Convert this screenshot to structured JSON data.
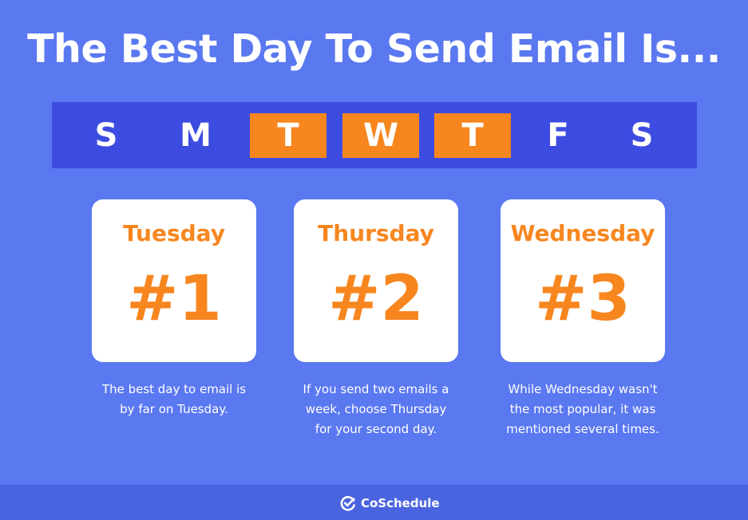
{
  "title": "The Best Day To Send Email Is...",
  "days": [
    "S",
    "M",
    "T",
    "W",
    "T",
    "F",
    "S"
  ],
  "highlighted_days": [
    2,
    3,
    4
  ],
  "colors": {
    "background": "#5a78f0",
    "strip": "#3d4ce0",
    "accent": "#f7861f",
    "card": "#ffffff",
    "footer": "#4a64e0"
  },
  "cards": [
    {
      "day": "Tuesday",
      "rank": "#1",
      "description": [
        "The best day to email is",
        "by far on Tuesday."
      ]
    },
    {
      "day": "Thursday",
      "rank": "#2",
      "description": [
        "If you send two emails a",
        "week,  choose Thursday",
        "for your second day."
      ]
    },
    {
      "day": "Wednesday",
      "rank": "#3",
      "description": [
        "While Wednesday wasn't",
        "the most popular, it was",
        "mentioned several times."
      ]
    }
  ],
  "footer": {
    "brand": "CoSchedule",
    "logo_icon": "checkmark-circle-icon"
  }
}
